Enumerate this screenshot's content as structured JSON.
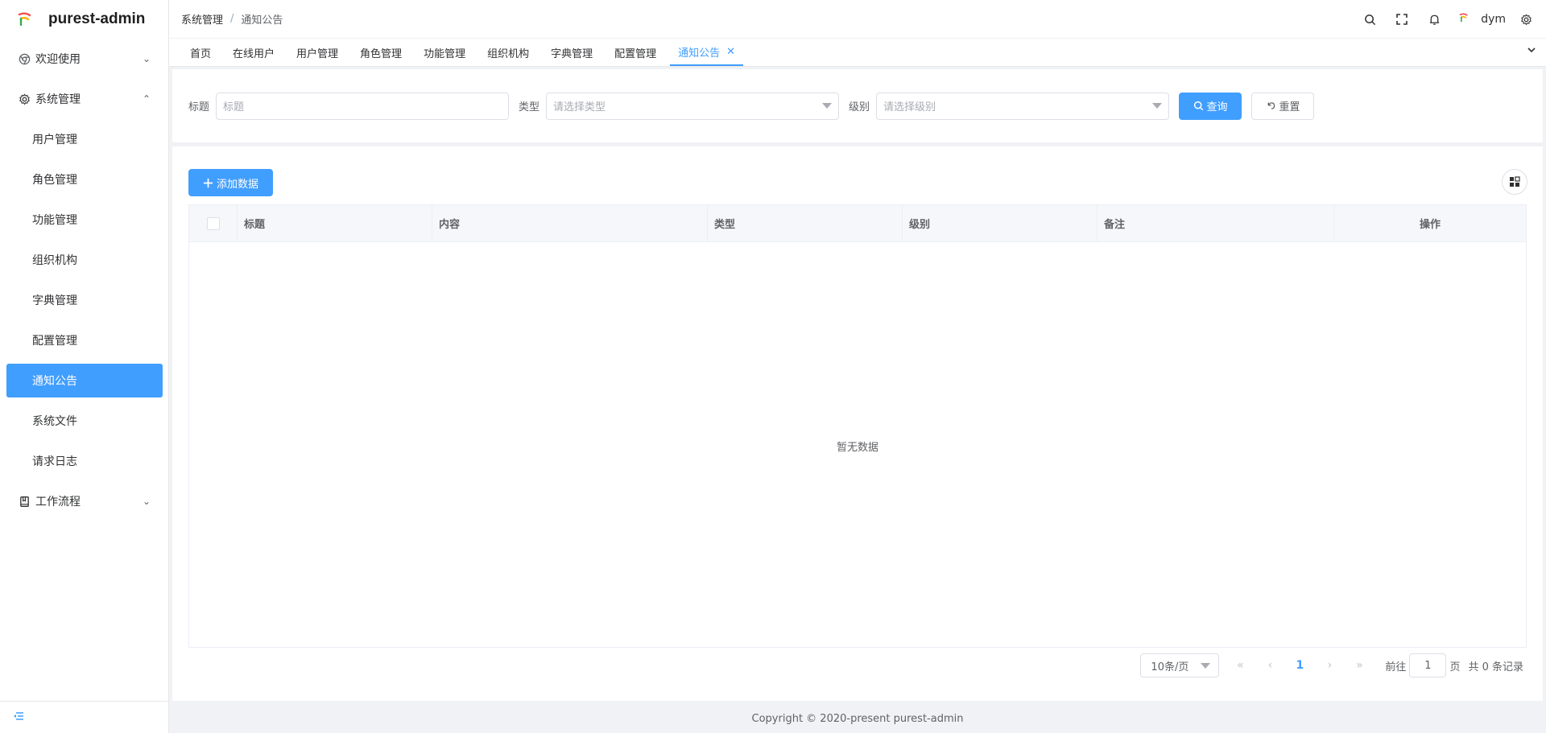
{
  "app": {
    "title": "purest-admin"
  },
  "sidebar": {
    "groups": [
      {
        "label": "欢迎使用",
        "icon": "chrome-icon",
        "expanded": false
      },
      {
        "label": "系统管理",
        "icon": "gear-icon",
        "expanded": true
      },
      {
        "label": "工作流程",
        "icon": "book-icon",
        "expanded": false
      }
    ],
    "sub_items": [
      "用户管理",
      "角色管理",
      "功能管理",
      "组织机构",
      "字典管理",
      "配置管理",
      "通知公告",
      "系统文件",
      "请求日志"
    ],
    "active_item": "通知公告",
    "collapse_icon": "collapse-menu-icon"
  },
  "header": {
    "breadcrumb": [
      "系统管理",
      "通知公告"
    ],
    "breadcrumb_sep": "/",
    "user": "dym",
    "icons": [
      "search-icon",
      "fullscreen-icon",
      "bell-icon",
      "settings-icon"
    ]
  },
  "tabs": {
    "items": [
      "首页",
      "在线用户",
      "用户管理",
      "角色管理",
      "功能管理",
      "组织机构",
      "字典管理",
      "配置管理",
      "通知公告"
    ],
    "active": "通知公告"
  },
  "search": {
    "title_label": "标题",
    "title_placeholder": "标题",
    "type_label": "类型",
    "type_placeholder": "请选择类型",
    "level_label": "级别",
    "level_placeholder": "请选择级别",
    "query_button": "查询",
    "reset_button": "重置"
  },
  "table": {
    "add_button": "添加数据",
    "columns": [
      "标题",
      "内容",
      "类型",
      "级别",
      "备注",
      "操作"
    ],
    "empty_text": "暂无数据"
  },
  "pagination": {
    "page_size": "10条/页",
    "current_page": "1",
    "goto_prefix": "前往",
    "goto_value": "1",
    "goto_suffix": "页",
    "total_text": "共 0 条记录"
  },
  "footer": {
    "copyright": "Copyright © 2020-present purest-admin"
  },
  "colors": {
    "primary": "#409eff",
    "text": "#303133",
    "muted": "#606266",
    "border": "#dcdfe6"
  }
}
